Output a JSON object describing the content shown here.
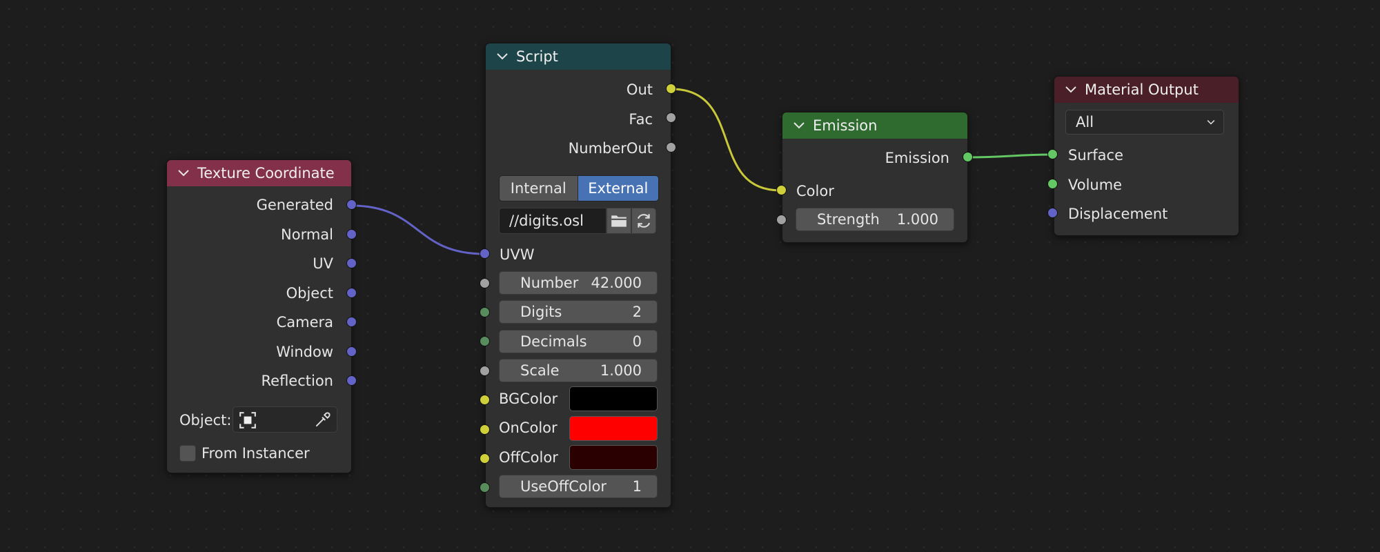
{
  "colors": {
    "background": "#1d1d1d",
    "node_body": "#303030",
    "header_texture": "#83314a",
    "header_script": "#1d4549",
    "header_emission": "#2f6b2f",
    "header_output": "#4a1f28",
    "wire_yellow": "#c8c83a",
    "wire_blue": "#6363c7",
    "wire_green": "#63c763",
    "active_blue": "#4772b3"
  },
  "texture_coordinate": {
    "title": "Texture Coordinate",
    "outputs": [
      "Generated",
      "Normal",
      "UV",
      "Object",
      "Camera",
      "Window",
      "Reflection"
    ],
    "object_label": "Object:",
    "from_instancer_label": "From Instancer",
    "from_instancer_checked": false,
    "icons": [
      "chevron-down-icon",
      "object-icon",
      "eyedropper-icon"
    ]
  },
  "script": {
    "title": "Script",
    "outputs": [
      "Out",
      "Fac",
      "NumberOut"
    ],
    "mode_internal": "Internal",
    "mode_external": "External",
    "mode_selected": "External",
    "filepath": "//digits.osl",
    "uvw_label": "UVW",
    "number_label": "Number",
    "number_value": "42.000",
    "digits_label": "Digits",
    "digits_value": "2",
    "decimals_label": "Decimals",
    "decimals_value": "0",
    "scale_label": "Scale",
    "scale_value": "1.000",
    "bgcolor_label": "BGColor",
    "bgcolor": "#000000",
    "oncolor_label": "OnColor",
    "oncolor": "#ff0000",
    "offcolor_label": "OffColor",
    "offcolor": "#2a0000",
    "useoffcolor_label": "UseOffColor",
    "useoffcolor_value": "1",
    "icons": [
      "folder-icon",
      "reload-icon"
    ]
  },
  "emission": {
    "title": "Emission",
    "output": "Emission",
    "color_label": "Color",
    "strength_label": "Strength",
    "strength_value": "1.000"
  },
  "material_output": {
    "title": "Material Output",
    "target": "All",
    "inputs": [
      "Surface",
      "Volume",
      "Displacement"
    ]
  }
}
